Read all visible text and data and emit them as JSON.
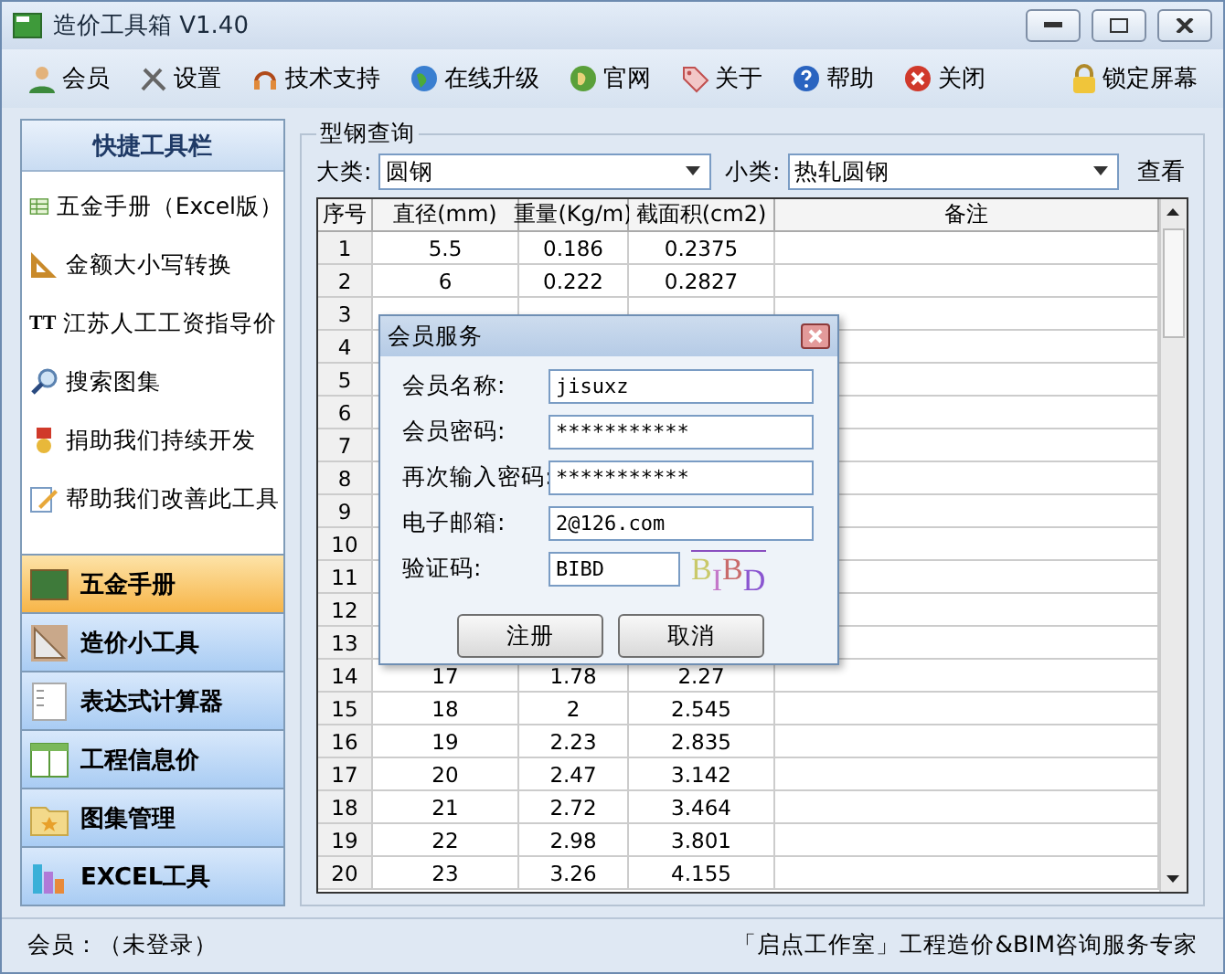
{
  "window": {
    "title": "造价工具箱 V1.40"
  },
  "toolbar": [
    {
      "label": "会员"
    },
    {
      "label": "设置"
    },
    {
      "label": "技术支持"
    },
    {
      "label": "在线升级"
    },
    {
      "label": "官网"
    },
    {
      "label": "关于"
    },
    {
      "label": "帮助"
    },
    {
      "label": "关闭"
    }
  ],
  "lock_button": {
    "label": "锁定屏幕"
  },
  "quick_tools": {
    "title": "快捷工具栏",
    "items": [
      {
        "label": "五金手册（Excel版）"
      },
      {
        "label": "金额大小写转换"
      },
      {
        "label": "江苏人工工资指导价",
        "icon_text": "TT"
      },
      {
        "label": "搜索图集"
      },
      {
        "label": "捐助我们持续开发"
      },
      {
        "label": "帮助我们改善此工具"
      }
    ]
  },
  "nav": [
    {
      "label": "五金手册",
      "selected": true
    },
    {
      "label": "造价小工具",
      "selected": false
    },
    {
      "label": "表达式计算器",
      "selected": false
    },
    {
      "label": "工程信息价",
      "selected": false
    },
    {
      "label": "图集管理",
      "selected": false
    },
    {
      "label": "EXCEL工具",
      "selected": false
    }
  ],
  "group": {
    "title": "型钢查询",
    "category_label": "大类:",
    "category": "圆钢",
    "subcategory_label": "小类:",
    "subcategory": "热轧圆钢",
    "view_button": "查看"
  },
  "table": {
    "columns": [
      "序号",
      "直径(mm)",
      "重量(Kg/m)",
      "截面积(cm2)",
      "备注"
    ],
    "rows": [
      [
        "1",
        "5.5",
        "0.186",
        "0.2375"
      ],
      [
        "2",
        "6",
        "0.222",
        "0.2827"
      ],
      [
        "3"
      ],
      [
        "4"
      ],
      [
        "5"
      ],
      [
        "6"
      ],
      [
        "7"
      ],
      [
        "8"
      ],
      [
        "9"
      ],
      [
        "10"
      ],
      [
        "11"
      ],
      [
        "12"
      ],
      [
        "13"
      ],
      [
        "14",
        "17",
        "1.78",
        "2.27"
      ],
      [
        "15",
        "18",
        "2",
        "2.545"
      ],
      [
        "16",
        "19",
        "2.23",
        "2.835"
      ],
      [
        "17",
        "20",
        "2.47",
        "3.142"
      ],
      [
        "18",
        "21",
        "2.72",
        "3.464"
      ],
      [
        "19",
        "22",
        "2.98",
        "3.801"
      ],
      [
        "20",
        "23",
        "3.26",
        "4.155"
      ]
    ]
  },
  "dialog": {
    "title": "会员服务",
    "fields": [
      {
        "label": "会员名称:",
        "value": "jisuxz"
      },
      {
        "label": "会员密码:",
        "value": "***********"
      },
      {
        "label": "再次输入密码:",
        "value": "***********"
      },
      {
        "label": "电子邮箱:",
        "value": "2@126.com"
      },
      {
        "label": "验证码:",
        "value": "BIBD"
      }
    ],
    "captcha": "BIBD",
    "buttons": [
      "注册",
      "取消"
    ]
  },
  "status_bar": {
    "left": "会员：（未登录）",
    "right": "「启点工作室」工程造价&BIM咨询服务专家"
  }
}
